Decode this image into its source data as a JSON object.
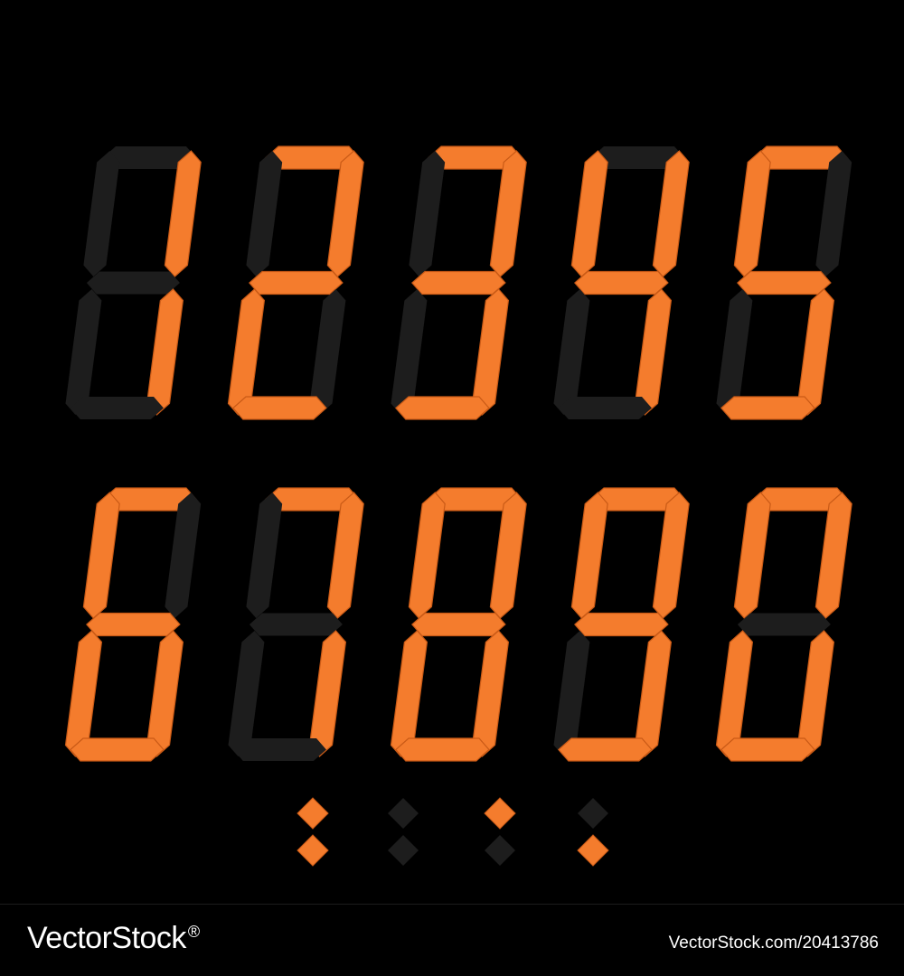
{
  "display": {
    "colors": {
      "lit": "#f47c2d",
      "lit_stroke": "#c95a16",
      "unlit": "#1d1d1d",
      "background": "#000000"
    },
    "rows": [
      {
        "digits": [
          {
            "value": "1",
            "lit": [
              false,
              false,
              true,
              false,
              false,
              true,
              false
            ]
          },
          {
            "value": "2",
            "lit": [
              true,
              false,
              true,
              true,
              true,
              false,
              true
            ]
          },
          {
            "value": "3",
            "lit": [
              true,
              false,
              true,
              true,
              false,
              true,
              true
            ]
          },
          {
            "value": "4",
            "lit": [
              false,
              true,
              true,
              true,
              false,
              true,
              false
            ]
          },
          {
            "value": "5",
            "lit": [
              true,
              true,
              false,
              true,
              false,
              true,
              true
            ]
          }
        ]
      },
      {
        "digits": [
          {
            "value": "6",
            "lit": [
              true,
              true,
              false,
              true,
              true,
              true,
              true
            ]
          },
          {
            "value": "7",
            "lit": [
              true,
              false,
              true,
              false,
              false,
              true,
              false
            ]
          },
          {
            "value": "8",
            "lit": [
              true,
              true,
              true,
              true,
              true,
              true,
              true
            ]
          },
          {
            "value": "9",
            "lit": [
              true,
              true,
              true,
              true,
              false,
              true,
              true
            ]
          },
          {
            "value": "0",
            "lit": [
              true,
              true,
              true,
              false,
              true,
              true,
              true
            ]
          }
        ]
      }
    ],
    "separators": [
      {
        "name": "colon-lit",
        "top_lit": true,
        "bottom_lit": true
      },
      {
        "name": "colon-unlit",
        "top_lit": false,
        "bottom_lit": false
      },
      {
        "name": "colon-top-lit",
        "top_lit": true,
        "bottom_lit": false
      },
      {
        "name": "colon-bottom-lit",
        "top_lit": false,
        "bottom_lit": true
      }
    ]
  },
  "footer": {
    "brand": "VectorStock",
    "brand_mark": "®",
    "image_id": "VectorStock.com/20413786"
  }
}
